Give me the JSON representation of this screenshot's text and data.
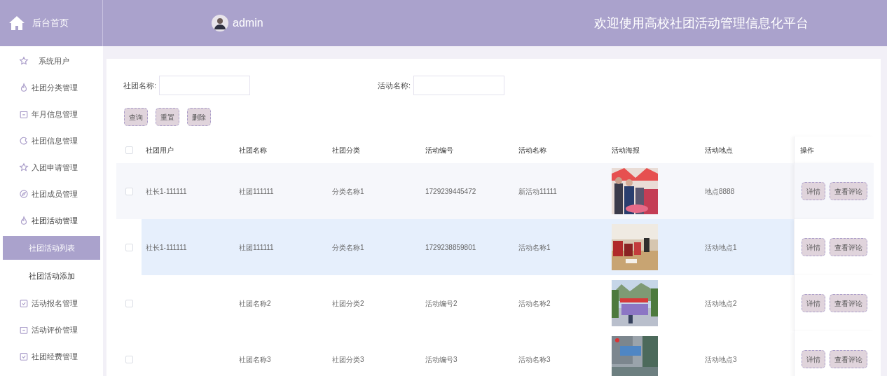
{
  "sidebar": {
    "home_label": "后台首页",
    "items": [
      {
        "label": "系统用户",
        "expanded": false
      },
      {
        "label": "社团分类管理",
        "expanded": false
      },
      {
        "label": "年月信息管理",
        "expanded": false
      },
      {
        "label": "社团信息管理",
        "expanded": false
      },
      {
        "label": "入团申请管理",
        "expanded": false
      },
      {
        "label": "社团成员管理",
        "expanded": false
      },
      {
        "label": "社团活动管理",
        "expanded": true,
        "children": [
          {
            "label": "社团活动列表",
            "selected": true
          },
          {
            "label": "社团活动添加",
            "selected": false
          }
        ]
      },
      {
        "label": "活动报名管理",
        "expanded": false
      },
      {
        "label": "活动评价管理",
        "expanded": false
      },
      {
        "label": "社团经费管理",
        "expanded": false
      }
    ]
  },
  "header": {
    "user": "admin",
    "title": "欢迎使用高校社团活动管理信息化平台"
  },
  "search": {
    "fields": [
      {
        "label": "社团名称:"
      },
      {
        "label": "活动名称:"
      }
    ],
    "buttons": [
      "查询",
      "重置",
      "删除"
    ]
  },
  "table": {
    "all_checked": false,
    "columns": [
      "社团用户",
      "社团名称",
      "社团分类",
      "活动编号",
      "活动名称",
      "活动海报",
      "活动地点",
      "操作"
    ],
    "rows": [
      {
        "checked": false,
        "highlighted": false,
        "cells": [
          "社长1-111111",
          "社团111111",
          "分类名称1",
          "1729239445472",
          "新活动11111"
        ],
        "poster": {
          "kind": "picture"
        },
        "location": "地点8888",
        "actions": [
          "详情",
          "查看评论"
        ]
      },
      {
        "checked": false,
        "highlighted": true,
        "cells": [
          "社长1-111111",
          "社团111111",
          "分类名称1",
          "1729238859801",
          "活动名称1"
        ],
        "poster": {
          "kind": "picture"
        },
        "location": "活动地点1",
        "actions": [
          "详情",
          "查看评论"
        ]
      },
      {
        "checked": false,
        "highlighted": false,
        "cells": [
          "",
          "社团名称2",
          "社团分类2",
          "活动编号2",
          "活动名称2"
        ],
        "poster": {
          "kind": "picture"
        },
        "location": "活动地点2",
        "actions": [
          "详情",
          "查看评论"
        ]
      },
      {
        "checked": false,
        "highlighted": false,
        "cells": [
          "",
          "社团名称3",
          "社团分类3",
          "活动编号3",
          "活动名称3"
        ],
        "poster": {
          "kind": "picture"
        },
        "location": "活动地点3",
        "actions": [
          "详情",
          "查看评论"
        ]
      }
    ]
  }
}
